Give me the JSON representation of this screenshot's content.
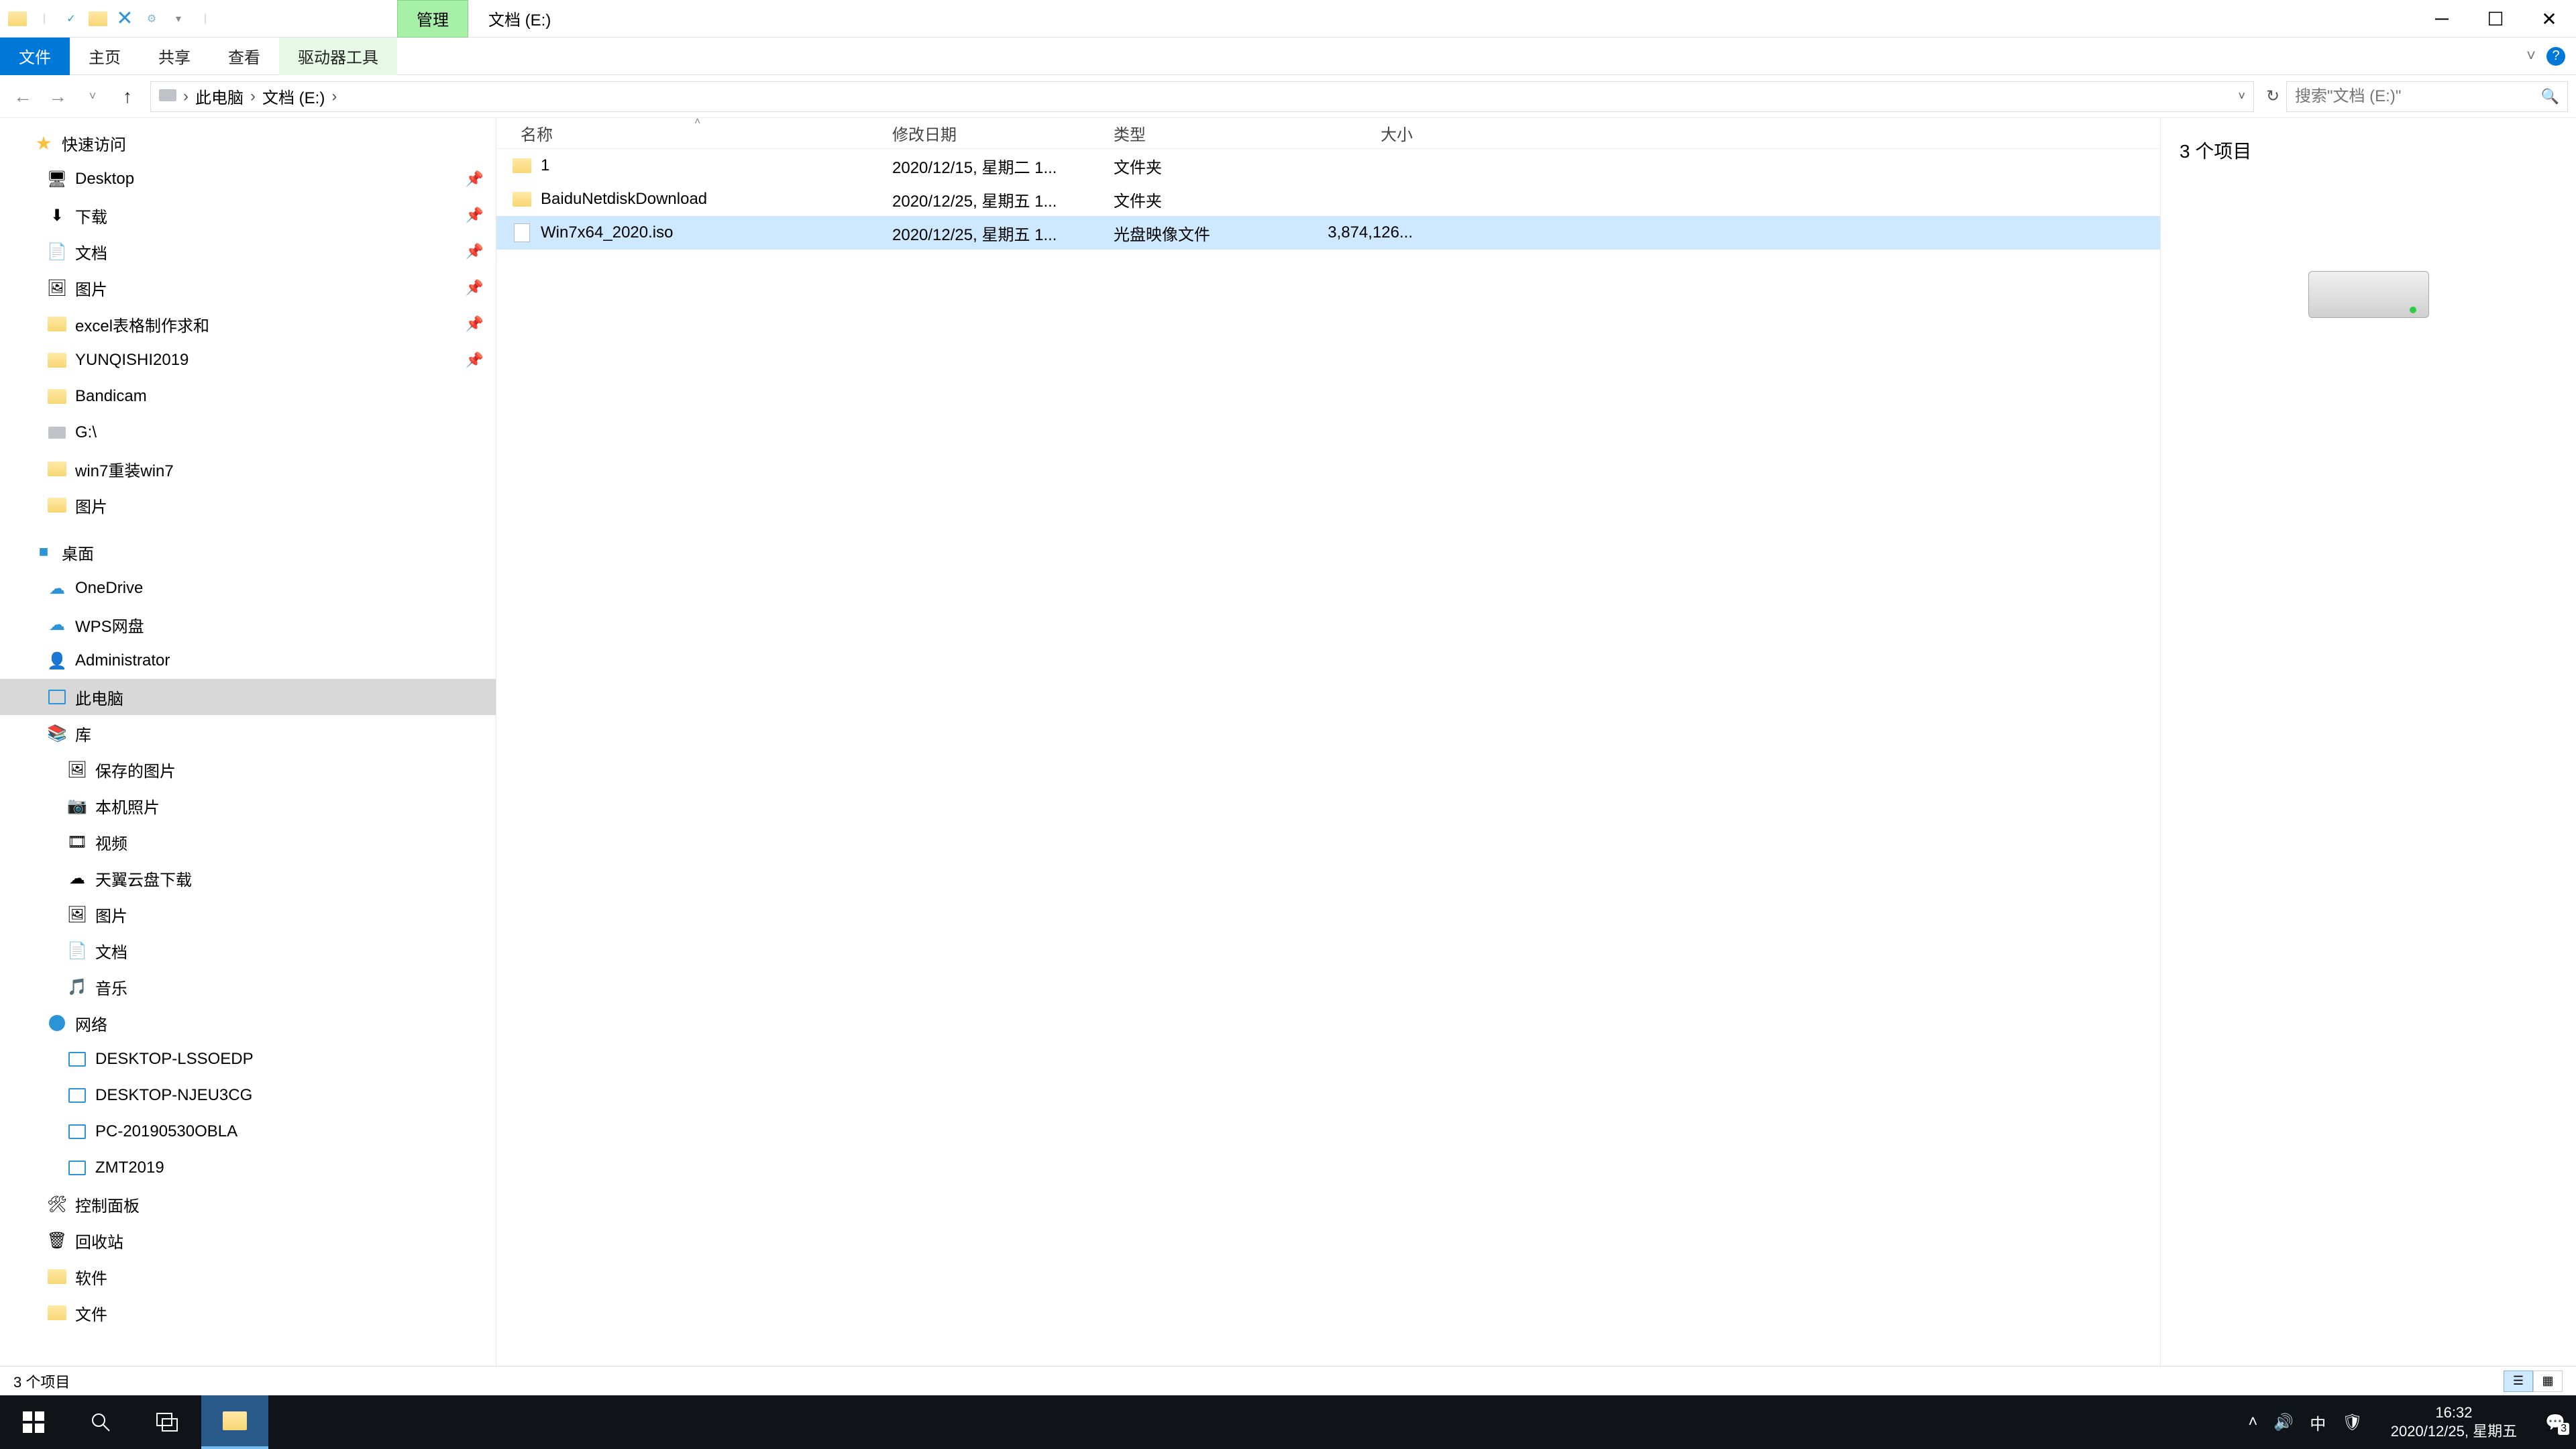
{
  "titlebar": {
    "context_tab": "管理",
    "window_title": "文档 (E:)"
  },
  "ribbon": {
    "file": "文件",
    "home": "主页",
    "share": "共享",
    "view": "查看",
    "drive_tools": "驱动器工具"
  },
  "breadcrumb": {
    "this_pc": "此电脑",
    "drive": "文档 (E:)"
  },
  "search": {
    "placeholder": "搜索\"文档 (E:)\""
  },
  "tree": {
    "quick_access": "快速访问",
    "desktop": "Desktop",
    "downloads": "下载",
    "documents": "文档",
    "pictures": "图片",
    "excel": "excel表格制作求和",
    "yunqishi": "YUNQISHI2019",
    "bandicam": "Bandicam",
    "gdrive": "G:\\",
    "win7reinstall": "win7重装win7",
    "pictures2": "图片",
    "desktop_cn": "桌面",
    "onedrive": "OneDrive",
    "wps": "WPS网盘",
    "admin": "Administrator",
    "this_pc": "此电脑",
    "libraries": "库",
    "saved_pictures": "保存的图片",
    "camera_roll": "本机照片",
    "videos": "视频",
    "tianyi": "天翼云盘下载",
    "pictures_lib": "图片",
    "documents_lib": "文档",
    "music": "音乐",
    "network": "网络",
    "pc1": "DESKTOP-LSSOEDP",
    "pc2": "DESKTOP-NJEU3CG",
    "pc3": "PC-20190530OBLA",
    "pc4": "ZMT2019",
    "control_panel": "控制面板",
    "recycle": "回收站",
    "software": "软件",
    "files": "文件"
  },
  "columns": {
    "name": "名称",
    "date": "修改日期",
    "type": "类型",
    "size": "大小"
  },
  "files": [
    {
      "name": "1",
      "date": "2020/12/15, 星期二 1...",
      "type": "文件夹",
      "size": "",
      "icon": "folder",
      "selected": false
    },
    {
      "name": "BaiduNetdiskDownload",
      "date": "2020/12/25, 星期五 1...",
      "type": "文件夹",
      "size": "",
      "icon": "folder",
      "selected": false
    },
    {
      "name": "Win7x64_2020.iso",
      "date": "2020/12/25, 星期五 1...",
      "type": "光盘映像文件",
      "size": "3,874,126...",
      "icon": "iso",
      "selected": true
    }
  ],
  "preview": {
    "count_label": "3 个项目"
  },
  "status": {
    "count": "3 个项目"
  },
  "taskbar": {
    "time": "16:32",
    "date": "2020/12/25, 星期五",
    "ime": "中",
    "notif_count": "3"
  }
}
